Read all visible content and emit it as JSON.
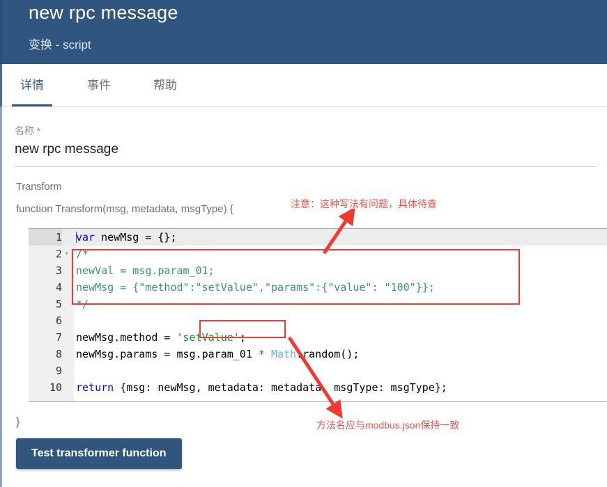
{
  "header": {
    "title": "new rpc message",
    "subtitle": "变换 - script",
    "bg_color": "#305680"
  },
  "tabs": [
    {
      "label": "详情",
      "active": true
    },
    {
      "label": "事件",
      "active": false
    },
    {
      "label": "帮助",
      "active": false
    }
  ],
  "form": {
    "name_label": "名称 *",
    "name_value": "new rpc message",
    "transform_label": "Transform",
    "function_signature": "function Transform(msg, metadata, msgType) {",
    "function_close": "}"
  },
  "editor": {
    "lines": [
      {
        "num": "1",
        "text": "var newMsg = {};"
      },
      {
        "num": "2",
        "text": "/*"
      },
      {
        "num": "3",
        "text": "newVal = msg.param_01;"
      },
      {
        "num": "4",
        "text": "newMsg = {\"method\":\"setValue\",\"params\":{\"value\": \"100\"}};"
      },
      {
        "num": "5",
        "text": "*/"
      },
      {
        "num": "6",
        "text": ""
      },
      {
        "num": "7",
        "text": "newMsg.method = 'setValue';"
      },
      {
        "num": "8",
        "text": "newMsg.params = msg.param_01 * Math.random();"
      },
      {
        "num": "9",
        "text": ""
      },
      {
        "num": "10",
        "text": "return {msg: newMsg, metadata: metadata, msgType: msgType};"
      }
    ]
  },
  "annotations": [
    {
      "text": "注意：这种写法有问题，具体待查",
      "color": "#f4514a"
    },
    {
      "text": "方法名应与modbus.json保持一致",
      "color": "#f4514a"
    }
  ],
  "footer": {
    "test_button_label": "Test transformer function"
  }
}
